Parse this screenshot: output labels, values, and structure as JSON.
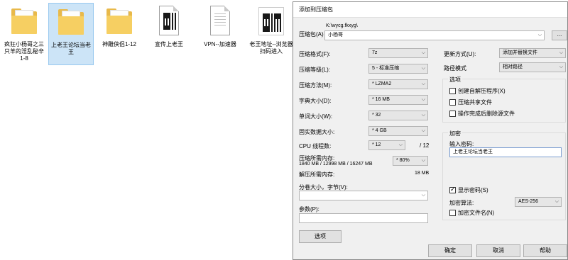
{
  "desktop": {
    "items": [
      {
        "label": "疯狂小杨哥之三只羊的淫乱秘辛1-8",
        "type": "folder",
        "selected": false
      },
      {
        "label": "上老王论坛当老王",
        "type": "folder",
        "selected": true
      },
      {
        "label": "神雕侠侣1-12",
        "type": "folder",
        "selected": false
      },
      {
        "label": "宣传上老王",
        "type": "qr",
        "selected": false
      },
      {
        "label": "VPN--加速器",
        "type": "document",
        "selected": false
      },
      {
        "label": "老王地址--浏览器扫码进入",
        "type": "qr",
        "selected": false
      }
    ]
  },
  "dialog": {
    "title": "添加到压缩包",
    "archive_label": "压缩包(A)",
    "archive_path": "K:\\wycg.fkxyg\\",
    "archive_name": "小杨哥",
    "browse_label": "...",
    "fields": {
      "format_label": "压缩格式(F):",
      "format_value": "7z",
      "level_label": "压缩等级(L):",
      "level_value": "5 - 标准压缩",
      "method_label": "压缩方法(M):",
      "method_value": "* LZMA2",
      "dict_label": "字典大小(D):",
      "dict_value": "* 16 MB",
      "word_label": "单词大小(W):",
      "word_value": "* 32",
      "solid_label": "固实数据大小:",
      "solid_value": "* 4 GB",
      "cpu_label": "CPU 线程数:",
      "cpu_value": "* 12",
      "cpu_max": "/ 12",
      "mem_label": "压缩所需内存:",
      "mem_detail": "1840 MB / 12998 MB / 16247 MB",
      "mem_percent": "* 80%",
      "decomp_label": "解压所需内存:",
      "decomp_value": "18 MB",
      "volume_label": "分卷大小，字节(V):",
      "params_label": "参数(P):"
    },
    "right": {
      "update_label": "更新方式(U):",
      "update_value": "添加并替换文件",
      "path_label": "路径模式",
      "path_value": "相对路径",
      "options_title": "选项",
      "opt_sfx": "创建自解压程序(X)",
      "opt_shared": "压缩共享文件",
      "opt_delete": "操作完成后删除源文件",
      "encrypt_title": "加密",
      "password_label": "输入密码:",
      "password_value": "上老王论坛当老王",
      "show_password": "显示密码(S)",
      "enc_method_label": "加密算法:",
      "enc_method_value": "AES-256",
      "encrypt_names": "加密文件名(N)"
    },
    "buttons": {
      "options": "选项",
      "ok": "确定",
      "cancel": "取消",
      "help": "帮助"
    },
    "arrow": "⌵"
  }
}
